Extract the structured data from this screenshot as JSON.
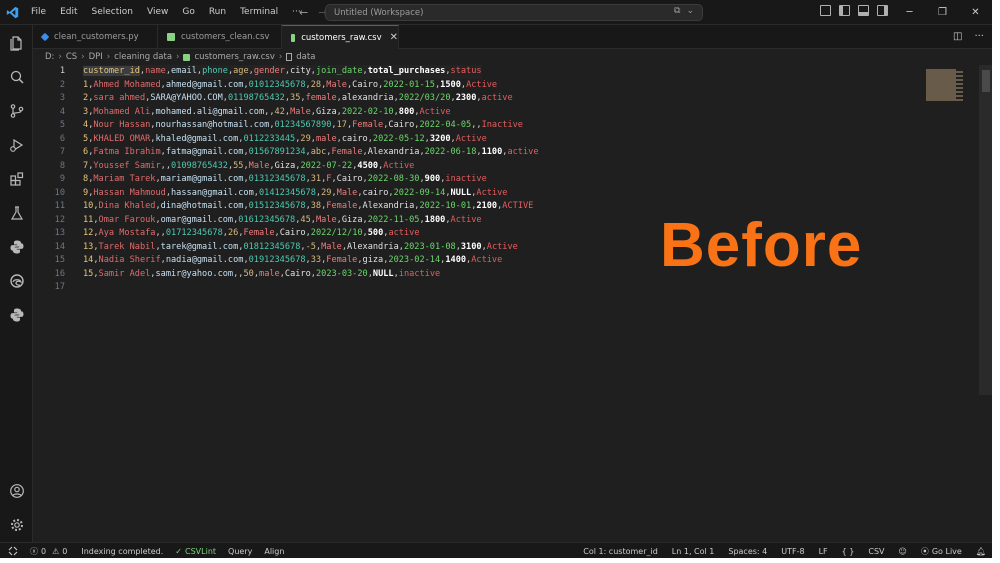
{
  "menu": [
    "File",
    "Edit",
    "Selection",
    "View",
    "Go",
    "Run",
    "Terminal",
    "···"
  ],
  "search": {
    "text": "Untitled (Workspace)"
  },
  "tabs": [
    {
      "label": "clean_customers.py",
      "icon_color": "#3b8eea"
    },
    {
      "label": "customers_clean.csv",
      "icon_color": "#89d185"
    },
    {
      "label": "customers_raw.csv",
      "icon_color": "#89d185"
    }
  ],
  "breadcrumb": [
    "D:",
    "CS",
    "DPI",
    "cleaning data",
    "customers_raw.csv",
    "data"
  ],
  "header_cells": [
    "customer_id",
    "name",
    "email",
    "phone",
    "age",
    "gender",
    "city",
    "join_date",
    "total_purchases",
    "status"
  ],
  "rows": [
    [
      "1",
      "Ahmed Mohamed",
      "ahmed@gmail.com",
      "01012345678",
      "28",
      "Male",
      "Cairo",
      "2022-01-15",
      "1500",
      "Active"
    ],
    [
      "2",
      "sara ahmed",
      "SARA@YAHOO.COM",
      "01198765432",
      "35",
      "female",
      "alexandria",
      "2022/03/20",
      "2300",
      "active"
    ],
    [
      "3",
      "Mohamed Ali",
      "mohamed.ali@gmail.com",
      "",
      "42",
      "Male",
      "Giza",
      "2022-02-10",
      "800",
      "Active"
    ],
    [
      "4",
      "Nour Hassan",
      "nourhassan@hotmail.com",
      "01234567890",
      "17",
      "Female",
      "Cairo",
      "2022-04-05",
      "",
      "Inactive"
    ],
    [
      "5",
      "KHALED OMAR",
      "khaled@gmail.com",
      "0112233445",
      "29",
      "male",
      "cairo",
      "2022-05-12",
      "3200",
      "Active"
    ],
    [
      "6",
      "Fatma Ibrahim",
      "fatma@gmail.com",
      "01567891234",
      "abc",
      "Female",
      "Alexandria",
      "2022-06-18",
      "1100",
      "active"
    ],
    [
      "7",
      "Youssef Samir",
      "",
      "01098765432",
      "55",
      "Male",
      "Giza",
      "2022-07-22",
      "4500",
      "Active"
    ],
    [
      "8",
      "Mariam Tarek",
      "mariam@gmail.com",
      "01312345678",
      "31",
      "F",
      "Cairo",
      "2022-08-30",
      "900",
      "inactive"
    ],
    [
      "9",
      "Hassan Mahmoud",
      "hassan@gmail.com",
      "01412345678",
      "29",
      "Male",
      "cairo",
      "2022-09-14",
      "NULL",
      "Active"
    ],
    [
      "10",
      "Dina Khaled",
      "dina@hotmail.com",
      "01512345678",
      "38",
      "Female",
      "Alexandria",
      "2022-10-01",
      "2100",
      "ACTIVE"
    ],
    [
      "11",
      "Omar Farouk",
      "omar@gmail.com",
      "01612345678",
      "45",
      "Male",
      "Giza",
      "2022-11-05",
      "1800",
      "Active"
    ],
    [
      "12",
      "Aya Mostafa",
      "",
      "01712345678",
      "26",
      "Female",
      "Cairo",
      "2022/12/10",
      "500",
      "active"
    ],
    [
      "13",
      "Tarek Nabil",
      "tarek@gmail.com",
      "01812345678",
      "-5",
      "Male",
      "Alexandria",
      "2023-01-08",
      "3100",
      "Active"
    ],
    [
      "14",
      "Nadia Sherif",
      "nadia@gmail.com",
      "01912345678",
      "33",
      "Female",
      "giza",
      "2023-02-14",
      "1400",
      "Active"
    ],
    [
      "15",
      "Samir Adel",
      "samir@yahoo.com",
      "",
      "50",
      "male",
      "Cairo",
      "2023-03-20",
      "NULL",
      "inactive"
    ]
  ],
  "line_numbers": [
    "1",
    "2",
    "3",
    "4",
    "5",
    "6",
    "7",
    "8",
    "9",
    "10",
    "11",
    "12",
    "13",
    "14",
    "15",
    "16",
    "17"
  ],
  "overlay": "Before",
  "status": {
    "errors": "0",
    "warnings": "0",
    "indexing": "Indexing completed.",
    "csvlint": "CSVLint",
    "query": "Query",
    "align": "Align",
    "column": "Col 1: customer_id",
    "position": "Ln 1, Col 1",
    "spaces": "Spaces: 4",
    "encoding": "UTF-8",
    "eol": "LF",
    "braces": "{ }",
    "language": "CSV",
    "golive": "Go Live"
  },
  "colors": {
    "accent": "#0078d4",
    "overlay": "#f97316"
  }
}
